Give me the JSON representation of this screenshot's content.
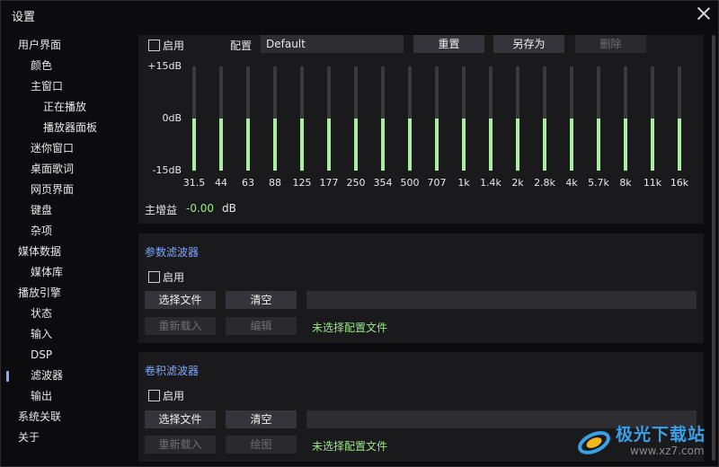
{
  "window": {
    "title": "设置"
  },
  "sidebar": {
    "items": [
      {
        "label": "用户界面",
        "level": 0
      },
      {
        "label": "颜色",
        "level": 1
      },
      {
        "label": "主窗口",
        "level": 1
      },
      {
        "label": "正在播放",
        "level": 2
      },
      {
        "label": "播放器面板",
        "level": 2
      },
      {
        "label": "迷你窗口",
        "level": 1
      },
      {
        "label": "桌面歌词",
        "level": 1
      },
      {
        "label": "网页界面",
        "level": 1
      },
      {
        "label": "键盘",
        "level": 1
      },
      {
        "label": "杂项",
        "level": 1
      },
      {
        "label": "媒体数据",
        "level": 0
      },
      {
        "label": "媒体库",
        "level": 1
      },
      {
        "label": "播放引擎",
        "level": 0
      },
      {
        "label": "状态",
        "level": 1
      },
      {
        "label": "输入",
        "level": 1
      },
      {
        "label": "DSP",
        "level": 1
      },
      {
        "label": "滤波器",
        "level": 1,
        "active": true
      },
      {
        "label": "输出",
        "level": 1
      },
      {
        "label": "系统关联",
        "level": 0
      },
      {
        "label": "关于",
        "level": 0
      }
    ]
  },
  "equalizer": {
    "enable_label": "启用",
    "preset_label": "配置",
    "preset_value": "Default",
    "reset_label": "重置",
    "save_as_label": "另存为",
    "delete_label": "删除",
    "db_max": "+15dB",
    "db_mid": "0dB",
    "db_min": "-15dB",
    "bands": [
      {
        "freq": "31.5",
        "gain_db": 0
      },
      {
        "freq": "44",
        "gain_db": 0
      },
      {
        "freq": "63",
        "gain_db": 0
      },
      {
        "freq": "88",
        "gain_db": 0
      },
      {
        "freq": "125",
        "gain_db": 0
      },
      {
        "freq": "177",
        "gain_db": 0
      },
      {
        "freq": "250",
        "gain_db": 0
      },
      {
        "freq": "354",
        "gain_db": 0
      },
      {
        "freq": "500",
        "gain_db": 0
      },
      {
        "freq": "707",
        "gain_db": 0
      },
      {
        "freq": "1k",
        "gain_db": 0
      },
      {
        "freq": "1.4k",
        "gain_db": 0
      },
      {
        "freq": "2k",
        "gain_db": 0
      },
      {
        "freq": "2.8k",
        "gain_db": 0
      },
      {
        "freq": "4k",
        "gain_db": 0
      },
      {
        "freq": "5.7k",
        "gain_db": 0
      },
      {
        "freq": "8k",
        "gain_db": 0
      },
      {
        "freq": "11k",
        "gain_db": 0
      },
      {
        "freq": "16k",
        "gain_db": 0
      }
    ],
    "master_gain_label": "主增益",
    "master_gain_value": "-0.00",
    "master_gain_unit": "dB",
    "fill_color": "#a8f0a0"
  },
  "param_filter": {
    "title": "参数滤波器",
    "enable_label": "启用",
    "choose_file_label": "选择文件",
    "clear_label": "清空",
    "file_path": "",
    "reload_label": "重新载入",
    "edit_label": "编辑",
    "status": "未选择配置文件"
  },
  "conv_filter": {
    "title": "卷积滤波器",
    "enable_label": "启用",
    "choose_file_label": "选择文件",
    "clear_label": "清空",
    "file_path": "",
    "reload_label": "重新载入",
    "plot_label": "绘图",
    "status": "未选择配置文件"
  },
  "watermark": {
    "brand": "极光下载站",
    "url": "www.xz7.com"
  },
  "colors": {
    "accent": "#7fa6ff",
    "ok": "#9be88a",
    "panel": "#1a1a1d",
    "background": "#0c0c0e"
  }
}
